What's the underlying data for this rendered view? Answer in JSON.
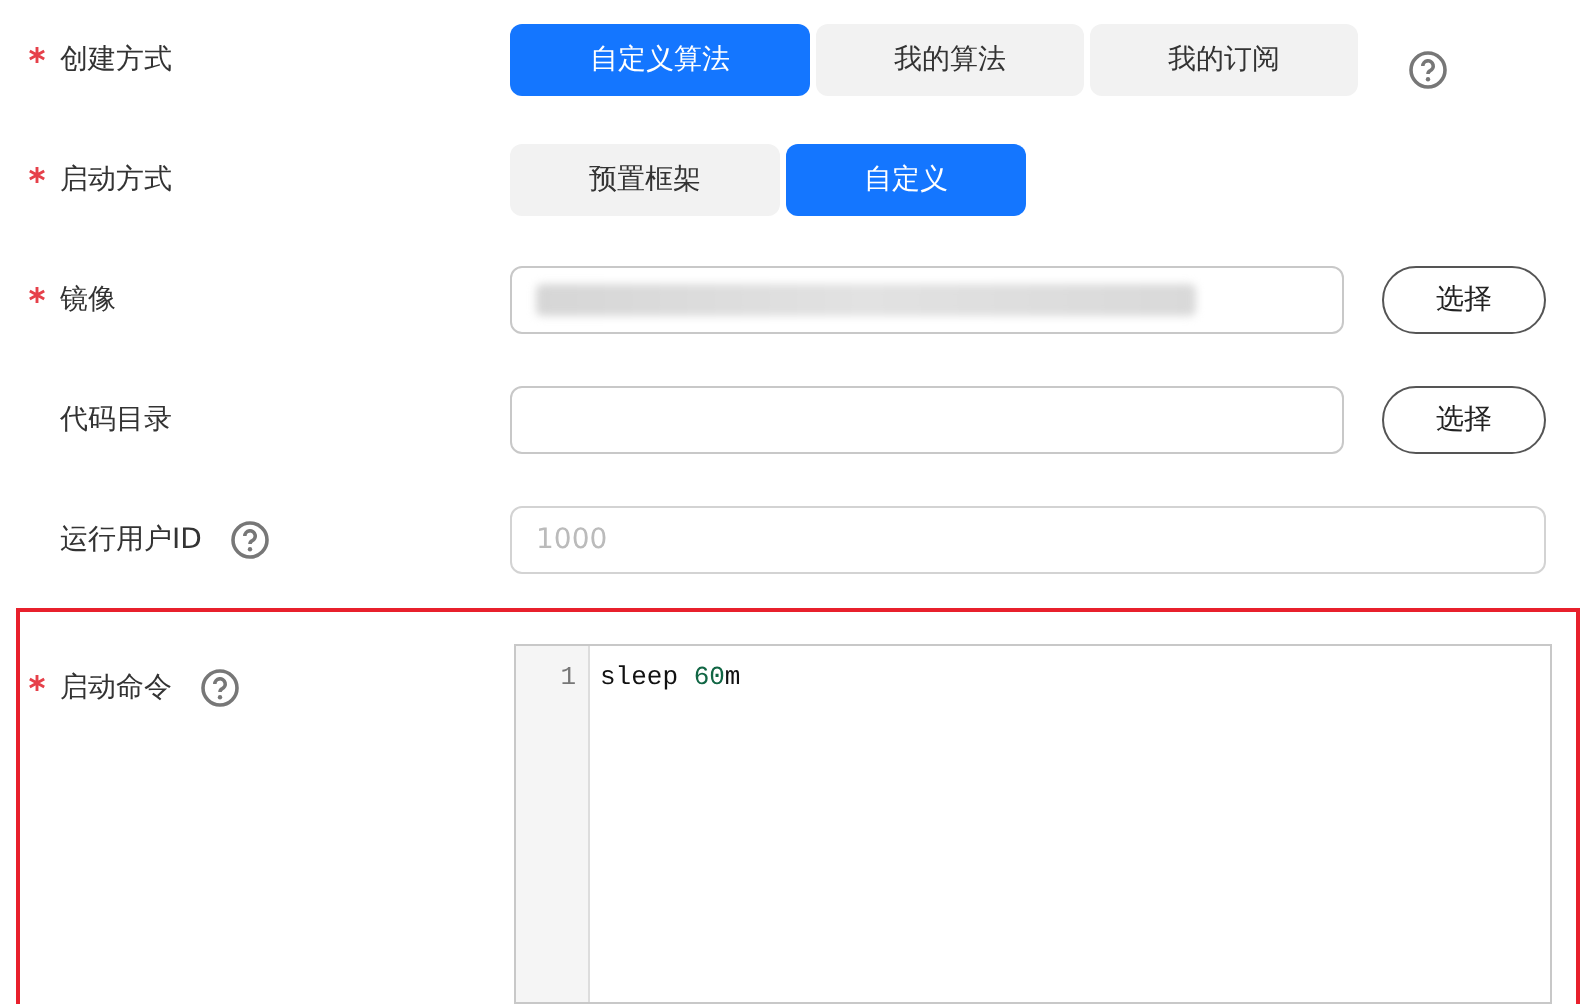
{
  "fields": [
    {
      "label": "创建方式",
      "required": true,
      "help": true,
      "kind": "segmented",
      "options": [
        {
          "label": "自定义算法",
          "selected": true
        },
        {
          "label": "我的算法",
          "selected": false
        },
        {
          "label": "我的订阅",
          "selected": false
        }
      ]
    },
    {
      "label": "启动方式",
      "required": true,
      "help": false,
      "kind": "segmented",
      "options": [
        {
          "label": "预置框架",
          "selected": false
        },
        {
          "label": "自定义",
          "selected": true
        }
      ]
    },
    {
      "label": "镜像",
      "required": true,
      "help": false,
      "kind": "picker",
      "value_blurred": true,
      "button": "选择"
    },
    {
      "label": "代码目录",
      "required": false,
      "help": false,
      "kind": "picker",
      "value_blurred": false,
      "button": "选择"
    },
    {
      "label": "运行用户ID",
      "required": false,
      "help": true,
      "kind": "text",
      "placeholder": "1000"
    },
    {
      "label": "启动命令",
      "required": true,
      "help": true,
      "kind": "code",
      "highlighted": true,
      "lines": [
        {
          "number": "1",
          "tokens": [
            {
              "text": "sleep ",
              "kind": "plain"
            },
            {
              "text": "60",
              "kind": "number"
            },
            {
              "text": "m",
              "kind": "plain"
            }
          ]
        }
      ]
    }
  ]
}
